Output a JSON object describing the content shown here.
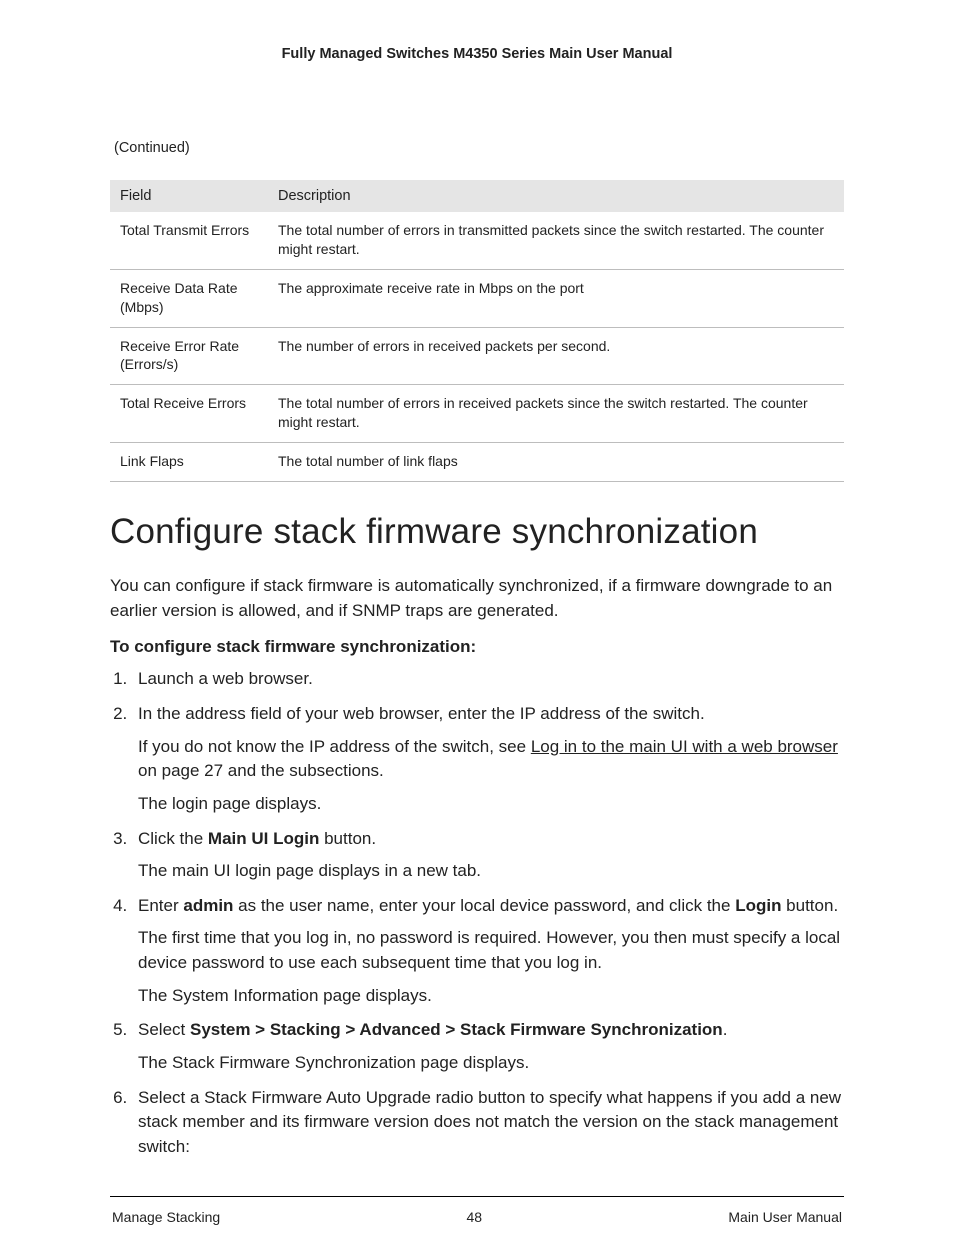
{
  "header": "Fully Managed Switches M4350 Series Main User Manual",
  "continued": "(Continued)",
  "table": {
    "headers": [
      "Field",
      "Description"
    ],
    "rows": [
      {
        "field": "Total Transmit Errors",
        "desc": "The total number of errors in transmitted packets since the switch restarted. The counter might restart."
      },
      {
        "field": "Receive Data Rate (Mbps)",
        "desc": "The approximate receive rate in Mbps on the port"
      },
      {
        "field": "Receive Error Rate (Errors/s)",
        "desc": "The number of errors in received packets per second."
      },
      {
        "field": "Total Receive Errors",
        "desc": "The total number of errors in received packets since the switch restarted. The counter might restart."
      },
      {
        "field": "Link Flaps",
        "desc": "The total number of link flaps"
      }
    ]
  },
  "section_title": "Configure stack firmware synchronization",
  "intro": "You can configure if stack firmware is automatically synchronized, if a firmware downgrade to an earlier version is allowed, and if SNMP traps are generated.",
  "subhead": "To configure stack firmware synchronization:",
  "steps": {
    "s1": "Launch a web browser.",
    "s2": "In the address field of your web browser, enter the IP address of the switch.",
    "s2_a_pre": "If you do not know the IP address of the switch, see ",
    "s2_a_link": "Log in to the main UI with a web browser",
    "s2_a_post": " on page 27 and the subsections.",
    "s2_b": "The login page displays.",
    "s3_pre": "Click the ",
    "s3_bold": "Main UI Login",
    "s3_post": " button.",
    "s3_a": "The main UI login page displays in a new tab.",
    "s4_pre": "Enter ",
    "s4_b1": "admin",
    "s4_mid": " as the user name, enter your local device password, and click the ",
    "s4_b2": "Login",
    "s4_post": " button.",
    "s4_a": "The first time that you log in, no password is required. However, you then must specify a local device password to use each subsequent time that you log in.",
    "s4_b": "The System Information page displays.",
    "s5_pre": "Select ",
    "s5_bold": "System > Stacking > Advanced > Stack Firmware Synchronization",
    "s5_post": ".",
    "s5_a": "The Stack Firmware Synchronization page displays.",
    "s6": "Select a Stack Firmware Auto Upgrade radio button to specify what happens if you add a new stack member and its firmware version does not match the version on the stack management switch:"
  },
  "footer": {
    "left": "Manage Stacking",
    "center": "48",
    "right": "Main User Manual"
  }
}
